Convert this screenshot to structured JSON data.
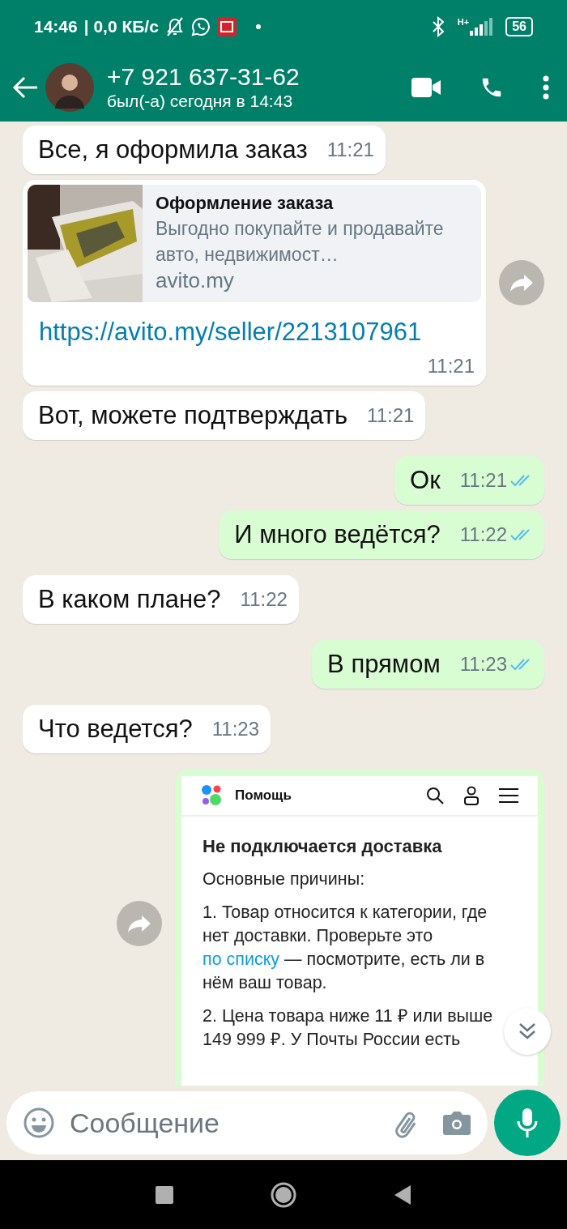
{
  "status_bar": {
    "time": "14:46",
    "speed": "| 0,0 КБ/с",
    "network": "H+",
    "battery": "56"
  },
  "header": {
    "title": "+7 921 637-31-62",
    "subtitle": "был(-а) сегодня в 14:43"
  },
  "messages": [
    {
      "kind": "text",
      "outgoing": false,
      "text": "Все, я оформила заказ",
      "time": "11:21"
    },
    {
      "kind": "link",
      "outgoing": false,
      "forward": true,
      "preview": {
        "title": "Оформление заказа",
        "description": "Выгодно покупайте и продавайте авто, недвижимост…",
        "domain": "avito.my"
      },
      "url": "https://avito.my/seller/2213107961",
      "time": "11:21"
    },
    {
      "kind": "text",
      "outgoing": false,
      "text": "Вот, можете подтверждать",
      "time": "11:21"
    },
    {
      "kind": "text",
      "outgoing": true,
      "text": "Ок",
      "time": "11:21",
      "read": true
    },
    {
      "kind": "text",
      "outgoing": true,
      "text": "И много ведётся?",
      "time": "11:22",
      "read": true
    },
    {
      "kind": "text",
      "outgoing": false,
      "text": "В каком плане?",
      "time": "11:22"
    },
    {
      "kind": "text",
      "outgoing": true,
      "text": "В прямом",
      "time": "11:23",
      "read": true
    },
    {
      "kind": "text",
      "outgoing": false,
      "text": "Что ведется?",
      "time": "11:23"
    },
    {
      "kind": "screenshot",
      "outgoing": true,
      "forward": true,
      "page": {
        "site_title": "Помощь",
        "heading": "Не подключается доставка",
        "intro": "Основные причины:",
        "paragraphs": [
          {
            "before": "1. Товар относится к категории, где нет доставки. Проверьте это ",
            "link": "по списку",
            "after": " — посмотрите, есть ли в нём ваш товар."
          },
          {
            "before": "2. Цена товара ниже 11 ₽ или выше 149 999 ₽. У Почты России есть"
          }
        ]
      }
    }
  ],
  "composer": {
    "placeholder": "Сообщение"
  }
}
